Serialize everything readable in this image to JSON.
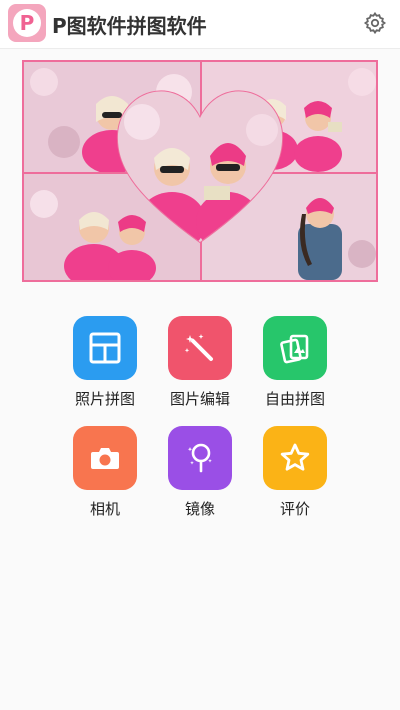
{
  "header": {
    "logo_letter": "P",
    "title": "P图软件拼图软件",
    "settings_icon": "gear-icon"
  },
  "collage": {
    "frame_color": "#ee6d9b"
  },
  "features": [
    {
      "label": "照片拼图",
      "icon": "grid-layout-icon",
      "color": "#2b9cf0"
    },
    {
      "label": "图片编辑",
      "icon": "magic-wand-icon",
      "color": "#f0546c"
    },
    {
      "label": "自由拼图",
      "icon": "photo-cards-icon",
      "color": "#27c66b"
    },
    {
      "label": "相机",
      "icon": "camera-icon",
      "color": "#f8754f"
    },
    {
      "label": "镜像",
      "icon": "mirror-icon",
      "color": "#9a4fe6"
    },
    {
      "label": "评价",
      "icon": "star-icon",
      "color": "#fbb316"
    }
  ]
}
